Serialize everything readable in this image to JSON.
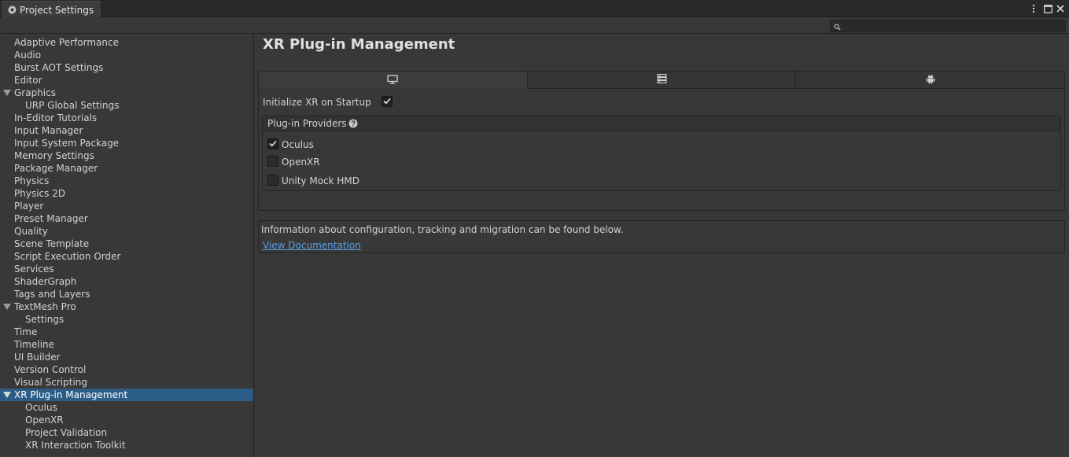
{
  "window": {
    "tab_title": "Project Settings",
    "icons": [
      "gear-icon",
      "kebab-menu-icon",
      "maximize-icon",
      "close-icon"
    ]
  },
  "search": {
    "placeholder": "",
    "value": ""
  },
  "sidebar": {
    "items": [
      {
        "label": "Adaptive Performance"
      },
      {
        "label": "Audio"
      },
      {
        "label": "Burst AOT Settings"
      },
      {
        "label": "Editor"
      },
      {
        "label": "Graphics",
        "expanded": true
      },
      {
        "label": "URP Global Settings",
        "child": true
      },
      {
        "label": "In-Editor Tutorials"
      },
      {
        "label": "Input Manager"
      },
      {
        "label": "Input System Package"
      },
      {
        "label": "Memory Settings"
      },
      {
        "label": "Package Manager"
      },
      {
        "label": "Physics"
      },
      {
        "label": "Physics 2D"
      },
      {
        "label": "Player"
      },
      {
        "label": "Preset Manager"
      },
      {
        "label": "Quality"
      },
      {
        "label": "Scene Template"
      },
      {
        "label": "Script Execution Order"
      },
      {
        "label": "Services"
      },
      {
        "label": "ShaderGraph"
      },
      {
        "label": "Tags and Layers"
      },
      {
        "label": "TextMesh Pro",
        "expanded": true
      },
      {
        "label": "Settings",
        "child": true
      },
      {
        "label": "Time"
      },
      {
        "label": "Timeline"
      },
      {
        "label": "UI Builder"
      },
      {
        "label": "Version Control"
      },
      {
        "label": "Visual Scripting"
      },
      {
        "label": "XR Plug-in Management",
        "expanded": true,
        "selected": true
      },
      {
        "label": "Oculus",
        "child": true
      },
      {
        "label": "OpenXR",
        "child": true
      },
      {
        "label": "Project Validation",
        "child": true
      },
      {
        "label": "XR Interaction Toolkit",
        "child": true
      }
    ]
  },
  "main": {
    "title": "XR Plug-in Management",
    "platform_tabs": [
      {
        "icon": "desktop-monitor-icon",
        "active": true
      },
      {
        "icon": "server-icon",
        "active": false
      },
      {
        "icon": "android-icon",
        "active": false
      }
    ],
    "init_on_startup": {
      "label": "Initialize XR on Startup",
      "checked": true
    },
    "providers": {
      "title": "Plug-in Providers",
      "help_icon": "help-icon",
      "items": [
        {
          "label": "Oculus",
          "checked": true
        },
        {
          "label": "OpenXR",
          "checked": false
        },
        {
          "label": "Unity Mock HMD",
          "checked": false
        }
      ]
    },
    "info": {
      "text": "Information about configuration, tracking and migration can be found below.",
      "link": "View Documentation"
    }
  },
  "colors": {
    "background": "#383838",
    "selection": "#2c5d87",
    "link": "#5c9ce6",
    "text": "#d2d2d2"
  }
}
